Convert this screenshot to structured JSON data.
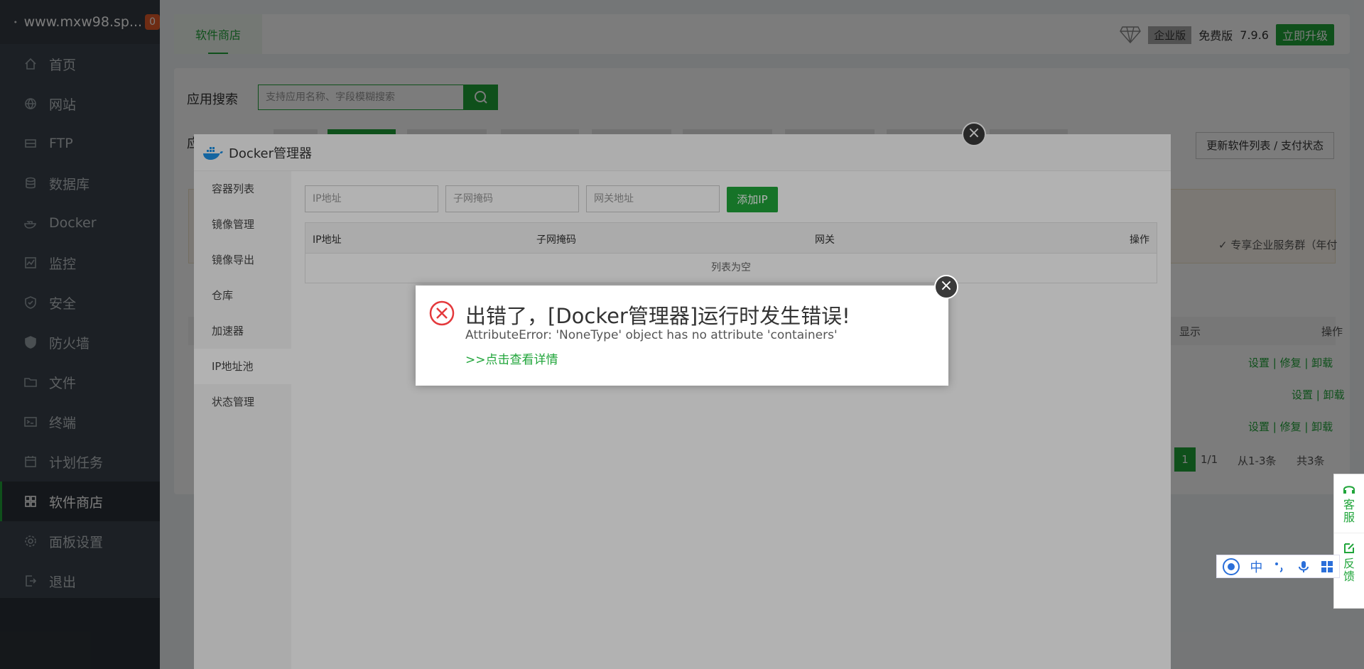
{
  "sidebar": {
    "site": "www.mxw98.sp...",
    "badge": "0",
    "items": [
      "首页",
      "网站",
      "FTP",
      "数据库",
      "Docker",
      "监控",
      "安全",
      "防火墙",
      "文件",
      "终端",
      "计划任务",
      "软件商店",
      "面板设置",
      "退出"
    ]
  },
  "topbar": {
    "tab": "软件商店",
    "edition": "企业版",
    "free": "免费版",
    "version": "7.9.6",
    "upgrade": "立即升级"
  },
  "panel": {
    "search_label": "应用搜索",
    "search_placeholder": "支持应用名称、字段模糊搜索",
    "cat_label": "应",
    "update": "更新软件列表 / 支付状态",
    "right_pay": "付）",
    "right_service": "✓ 专享企业服务群（年付",
    "col_show": "显示",
    "col_op": "操作",
    "row1": "设置 | 修复 | 卸载",
    "row2": "设置 | 卸载",
    "row3": "设置 | 修复 | 卸载",
    "page_cur": "1",
    "page_total": "1/1",
    "page_range": "从1-3条",
    "page_count": "共3条"
  },
  "docker": {
    "title": "Docker管理器",
    "menu": [
      "容器列表",
      "镜像管理",
      "镜像导出",
      "仓库",
      "加速器",
      "IP地址池",
      "状态管理"
    ],
    "ip_ph": "IP地址",
    "mask_ph": "子网掩码",
    "gw_ph": "网关地址",
    "add": "添加IP",
    "th_ip": "IP地址",
    "th_mask": "子网掩码",
    "th_gw": "网关",
    "th_op": "操作",
    "empty": "列表为空"
  },
  "error": {
    "title": "出错了，[Docker管理器]运行时发生错误!",
    "msg": "AttributeError: 'NoneType' object has no attribute 'containers'",
    "link": ">>点击查看详情"
  },
  "float": {
    "service": "客服",
    "feedback": "反馈"
  },
  "ifly": {
    "zh": "中"
  }
}
